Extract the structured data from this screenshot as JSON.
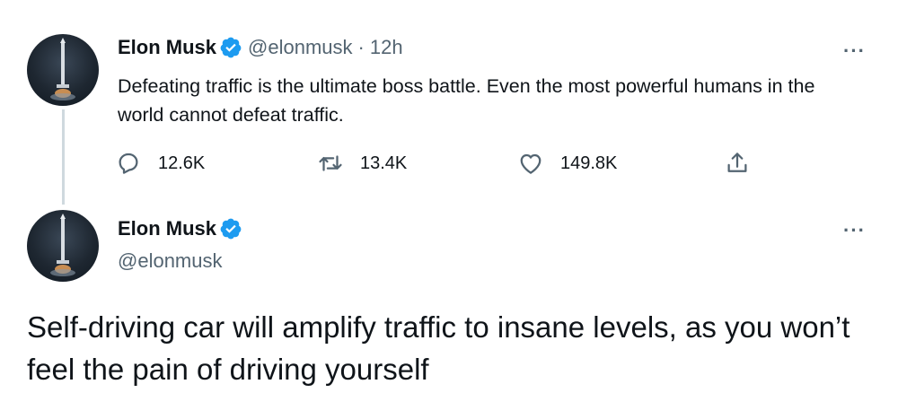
{
  "tweet1": {
    "name": "Elon Musk",
    "handle": "@elonmusk",
    "separator": "·",
    "time": "12h",
    "text": "Defeating traffic is the ultimate boss battle. Even the most powerful humans in the world cannot defeat traffic.",
    "more": "···",
    "stats": {
      "replies": "12.6K",
      "retweets": "13.4K",
      "likes": "149.8K"
    }
  },
  "tweet2": {
    "name": "Elon Musk",
    "handle": "@elonmusk",
    "more": "···",
    "text": "Self-driving car will amplify traffic to insane levels, as you won’t feel the pain of driving yourself"
  },
  "colors": {
    "verified": "#1d9bf0",
    "secondary_text": "#536471",
    "primary_text": "#0f1419",
    "thread_line": "#cfd9de"
  },
  "icons": [
    "avatar-rocket-icon",
    "verified-badge-icon",
    "reply-icon",
    "retweet-icon",
    "like-icon",
    "share-icon",
    "more-icon"
  ]
}
